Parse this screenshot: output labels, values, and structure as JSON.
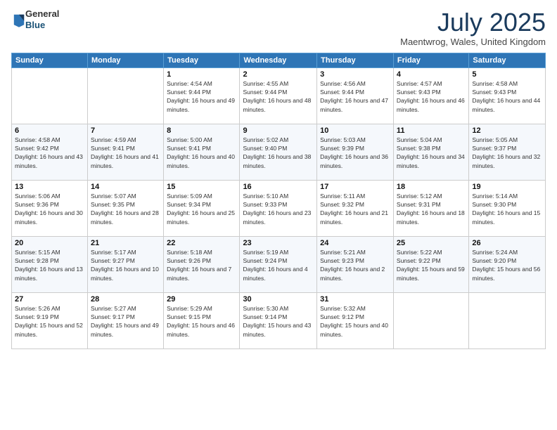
{
  "logo": {
    "general": "General",
    "blue": "Blue"
  },
  "header": {
    "month": "July 2025",
    "location": "Maentwrog, Wales, United Kingdom"
  },
  "days_of_week": [
    "Sunday",
    "Monday",
    "Tuesday",
    "Wednesday",
    "Thursday",
    "Friday",
    "Saturday"
  ],
  "weeks": [
    [
      {
        "day": "",
        "info": ""
      },
      {
        "day": "",
        "info": ""
      },
      {
        "day": "1",
        "info": "Sunrise: 4:54 AM\nSunset: 9:44 PM\nDaylight: 16 hours and 49 minutes."
      },
      {
        "day": "2",
        "info": "Sunrise: 4:55 AM\nSunset: 9:44 PM\nDaylight: 16 hours and 48 minutes."
      },
      {
        "day": "3",
        "info": "Sunrise: 4:56 AM\nSunset: 9:44 PM\nDaylight: 16 hours and 47 minutes."
      },
      {
        "day": "4",
        "info": "Sunrise: 4:57 AM\nSunset: 9:43 PM\nDaylight: 16 hours and 46 minutes."
      },
      {
        "day": "5",
        "info": "Sunrise: 4:58 AM\nSunset: 9:43 PM\nDaylight: 16 hours and 44 minutes."
      }
    ],
    [
      {
        "day": "6",
        "info": "Sunrise: 4:58 AM\nSunset: 9:42 PM\nDaylight: 16 hours and 43 minutes."
      },
      {
        "day": "7",
        "info": "Sunrise: 4:59 AM\nSunset: 9:41 PM\nDaylight: 16 hours and 41 minutes."
      },
      {
        "day": "8",
        "info": "Sunrise: 5:00 AM\nSunset: 9:41 PM\nDaylight: 16 hours and 40 minutes."
      },
      {
        "day": "9",
        "info": "Sunrise: 5:02 AM\nSunset: 9:40 PM\nDaylight: 16 hours and 38 minutes."
      },
      {
        "day": "10",
        "info": "Sunrise: 5:03 AM\nSunset: 9:39 PM\nDaylight: 16 hours and 36 minutes."
      },
      {
        "day": "11",
        "info": "Sunrise: 5:04 AM\nSunset: 9:38 PM\nDaylight: 16 hours and 34 minutes."
      },
      {
        "day": "12",
        "info": "Sunrise: 5:05 AM\nSunset: 9:37 PM\nDaylight: 16 hours and 32 minutes."
      }
    ],
    [
      {
        "day": "13",
        "info": "Sunrise: 5:06 AM\nSunset: 9:36 PM\nDaylight: 16 hours and 30 minutes."
      },
      {
        "day": "14",
        "info": "Sunrise: 5:07 AM\nSunset: 9:35 PM\nDaylight: 16 hours and 28 minutes."
      },
      {
        "day": "15",
        "info": "Sunrise: 5:09 AM\nSunset: 9:34 PM\nDaylight: 16 hours and 25 minutes."
      },
      {
        "day": "16",
        "info": "Sunrise: 5:10 AM\nSunset: 9:33 PM\nDaylight: 16 hours and 23 minutes."
      },
      {
        "day": "17",
        "info": "Sunrise: 5:11 AM\nSunset: 9:32 PM\nDaylight: 16 hours and 21 minutes."
      },
      {
        "day": "18",
        "info": "Sunrise: 5:12 AM\nSunset: 9:31 PM\nDaylight: 16 hours and 18 minutes."
      },
      {
        "day": "19",
        "info": "Sunrise: 5:14 AM\nSunset: 9:30 PM\nDaylight: 16 hours and 15 minutes."
      }
    ],
    [
      {
        "day": "20",
        "info": "Sunrise: 5:15 AM\nSunset: 9:28 PM\nDaylight: 16 hours and 13 minutes."
      },
      {
        "day": "21",
        "info": "Sunrise: 5:17 AM\nSunset: 9:27 PM\nDaylight: 16 hours and 10 minutes."
      },
      {
        "day": "22",
        "info": "Sunrise: 5:18 AM\nSunset: 9:26 PM\nDaylight: 16 hours and 7 minutes."
      },
      {
        "day": "23",
        "info": "Sunrise: 5:19 AM\nSunset: 9:24 PM\nDaylight: 16 hours and 4 minutes."
      },
      {
        "day": "24",
        "info": "Sunrise: 5:21 AM\nSunset: 9:23 PM\nDaylight: 16 hours and 2 minutes."
      },
      {
        "day": "25",
        "info": "Sunrise: 5:22 AM\nSunset: 9:22 PM\nDaylight: 15 hours and 59 minutes."
      },
      {
        "day": "26",
        "info": "Sunrise: 5:24 AM\nSunset: 9:20 PM\nDaylight: 15 hours and 56 minutes."
      }
    ],
    [
      {
        "day": "27",
        "info": "Sunrise: 5:26 AM\nSunset: 9:19 PM\nDaylight: 15 hours and 52 minutes."
      },
      {
        "day": "28",
        "info": "Sunrise: 5:27 AM\nSunset: 9:17 PM\nDaylight: 15 hours and 49 minutes."
      },
      {
        "day": "29",
        "info": "Sunrise: 5:29 AM\nSunset: 9:15 PM\nDaylight: 15 hours and 46 minutes."
      },
      {
        "day": "30",
        "info": "Sunrise: 5:30 AM\nSunset: 9:14 PM\nDaylight: 15 hours and 43 minutes."
      },
      {
        "day": "31",
        "info": "Sunrise: 5:32 AM\nSunset: 9:12 PM\nDaylight: 15 hours and 40 minutes."
      },
      {
        "day": "",
        "info": ""
      },
      {
        "day": "",
        "info": ""
      }
    ]
  ]
}
